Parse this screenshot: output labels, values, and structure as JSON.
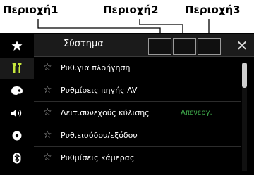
{
  "callouts": {
    "area1": "Περιοχή1",
    "area2": "Περιοχή2",
    "area3": "Περιοχή3"
  },
  "sidebar": {
    "items": [
      {
        "icon": "star-icon",
        "active": false
      },
      {
        "icon": "tools-icon",
        "active": true
      },
      {
        "icon": "theme-palette-icon",
        "active": false
      },
      {
        "icon": "speaker-icon",
        "active": false
      },
      {
        "icon": "disc-icon",
        "active": false
      },
      {
        "icon": "bluetooth-icon",
        "active": false
      }
    ]
  },
  "header": {
    "title": "Σύστημα",
    "close_label": "✕"
  },
  "menu": {
    "items": [
      {
        "label": "Ρυθ.για πλοήγηση",
        "value": ""
      },
      {
        "label": "Ρυθμίσεις πηγής AV",
        "value": ""
      },
      {
        "label": "Λειτ.συνεχούς κύλισης",
        "value": "Απενεργ."
      },
      {
        "label": "Ρυθ.εισόδου/εξόδου",
        "value": ""
      },
      {
        "label": "Ρυθμίσεις κάμερας",
        "value": ""
      }
    ]
  },
  "colors": {
    "accent_green": "#3ea84a",
    "background": "#000000"
  }
}
